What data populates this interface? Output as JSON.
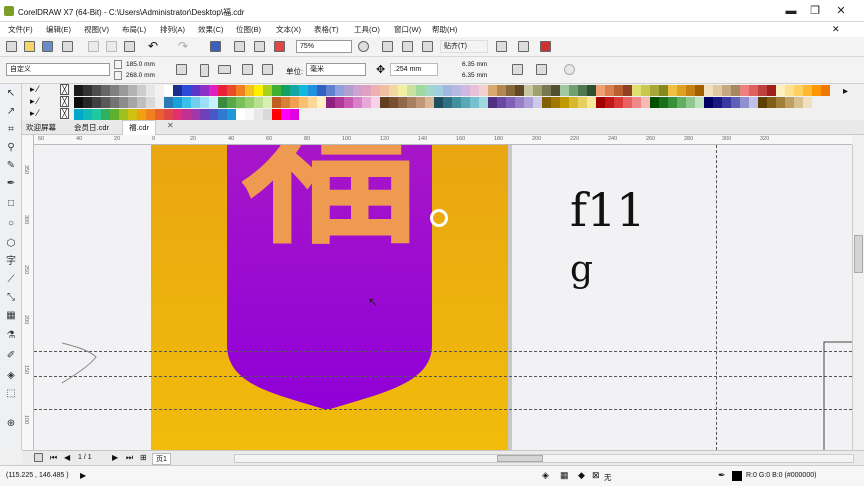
{
  "titlebar": {
    "title": "CorelDRAW X7 (64-Bit) - C:\\Users\\Administrator\\Desktop\\福.cdr",
    "min": "▬",
    "restore": "❐",
    "close": "✕"
  },
  "menubar": [
    "文件(F)",
    "编辑(E)",
    "视图(V)",
    "布局(L)",
    "排列(A)",
    "效果(C)",
    "位图(B)",
    "文本(X)",
    "表格(T)",
    "工具(O)",
    "窗口(W)",
    "帮助(H)"
  ],
  "toolbar_standard": {
    "zoom": "75%",
    "snap": "贴齐(T)"
  },
  "property_bar": {
    "preset": "自定义",
    "width": "185.0 mm",
    "height": "268.0 mm",
    "units_label": "单位:",
    "units": "毫米",
    "nudge": ".254 mm",
    "dup_x": "6.35 mm",
    "dup_y": "6.35 mm"
  },
  "doc_tabs": [
    "欢迎屏幕",
    "会员日.cdr",
    "福.cdr"
  ],
  "ruler_h": [
    "60",
    "40",
    "20",
    "0",
    "20",
    "40",
    "60",
    "80",
    "100",
    "120",
    "140",
    "160",
    "180",
    "200",
    "220",
    "240",
    "260",
    "280",
    "300",
    "320"
  ],
  "ruler_v": [
    "350",
    "300",
    "250",
    "200",
    "150",
    "100"
  ],
  "canvas": {
    "char": "福",
    "text1": "f11",
    "text2": "g",
    "shield_top": "#a716c8",
    "shield_bottom": "#9000d8",
    "glyph_color": "#ee9a50",
    "page_color": "#f1bc0b"
  },
  "page_nav": {
    "current": "1 / 1",
    "page_label": "页1"
  },
  "status": {
    "coords": "(115.225 , 146.485 )",
    "fill_none": "无",
    "color_info": "R:0 G:0 B:0 (#000000)"
  },
  "palette_rows": [
    [
      "#1a1a1a",
      "#333",
      "#4d4d4d",
      "#666",
      "#808080",
      "#999",
      "#b3b3b3",
      "#ccc",
      "#e6e6e6",
      "#f2f2f2",
      "#ffffff",
      "#1c2f8c",
      "#2c4bd8",
      "#5a37c8",
      "#8a2fc8",
      "#e020c0",
      "#e8203c",
      "#e84a2a",
      "#f08020",
      "#f8c020",
      "#fff000",
      "#a8d020",
      "#40b030",
      "#10a060",
      "#10a8a0",
      "#10b8e0",
      "#2090e0",
      "#3060c0",
      "#6080d0",
      "#90a0e0",
      "#b0a0d0",
      "#d0a0d0",
      "#e0a0c0",
      "#f0b0b0",
      "#f0c0a0",
      "#f0d8a0",
      "#f0f0a0",
      "#c8e0a0",
      "#a0d8a0",
      "#a0d8c8",
      "#a0d0e0",
      "#a0b8e0",
      "#b8b8e0",
      "#d0b8e0",
      "#e8c0d8",
      "#f0d0d0",
      "#d8a870",
      "#b08850",
      "#886838",
      "#604828",
      "#c8c8a0",
      "#a0a070",
      "#787850",
      "#505030",
      "#a0c8a0",
      "#70a070",
      "#507850",
      "#305030",
      "#f0a070",
      "#d88050",
      "#b86030",
      "#904020",
      "#e0e070",
      "#c8c850",
      "#a8a838",
      "#888820",
      "#f0c040",
      "#e0a020",
      "#c88010",
      "#a06000",
      "#f0e0c0",
      "#e0c8a0",
      "#c8a880",
      "#a88860",
      "#f08080",
      "#e06060",
      "#c04040",
      "#a02020",
      "#fff0c0",
      "#ffe090",
      "#ffd060",
      "#ffb830",
      "#ff9800",
      "#f07800"
    ],
    [
      "#0d0d0d",
      "#262626",
      "#404040",
      "#595959",
      "#737373",
      "#8c8c8c",
      "#a6a6a6",
      "#bfbfbf",
      "#d9d9d9",
      "#eeeeee",
      "#2a7ab8",
      "#1aa0d8",
      "#38c0e8",
      "#70d0f0",
      "#9ce0f8",
      "#c8f0ff",
      "#3a8a40",
      "#58a848",
      "#78c058",
      "#98d070",
      "#b8e090",
      "#d8f0b0",
      "#c06020",
      "#d88038",
      "#f0a050",
      "#f8c070",
      "#fcd898",
      "#fff0c8",
      "#902080",
      "#b03898",
      "#c858b0",
      "#d880c8",
      "#e8a8d8",
      "#f8d0e8",
      "#604020",
      "#785030",
      "#906848",
      "#a88060",
      "#c09878",
      "#d8b898",
      "#205060",
      "#307080",
      "#4090a0",
      "#58a8b8",
      "#78c0d0",
      "#a0d8e0",
      "#503080",
      "#6848a0",
      "#8060b8",
      "#9880c8",
      "#b0a0d8",
      "#d0c8e8",
      "#806000",
      "#a07800",
      "#c09800",
      "#d8b830",
      "#e8d060",
      "#f8e898",
      "#a00000",
      "#c01818",
      "#d83838",
      "#e86060",
      "#f08888",
      "#f8b8b8",
      "#005000",
      "#187018",
      "#389038",
      "#60b060",
      "#90c890",
      "#c0e0c0",
      "#000060",
      "#181880",
      "#3838a0",
      "#6060b8",
      "#9090d0",
      "#c0c0e8",
      "#604000",
      "#806018",
      "#a08038",
      "#c0a060",
      "#d8c090",
      "#f0e0c0"
    ],
    [
      "#00a8c8",
      "#10b8b8",
      "#20c8a0",
      "#30b060",
      "#60b030",
      "#a0c020",
      "#d0c010",
      "#f0a010",
      "#f08020",
      "#e86030",
      "#e04848",
      "#e03070",
      "#c03090",
      "#a038a8",
      "#7040b8",
      "#4858c8",
      "#3078d0",
      "#2098d8",
      "#ffffff",
      "#f8f8f8",
      "#e8e8e8",
      "#d8d8d8",
      "#ff0000",
      "#ff00ff",
      "#e000e0"
    ]
  ]
}
